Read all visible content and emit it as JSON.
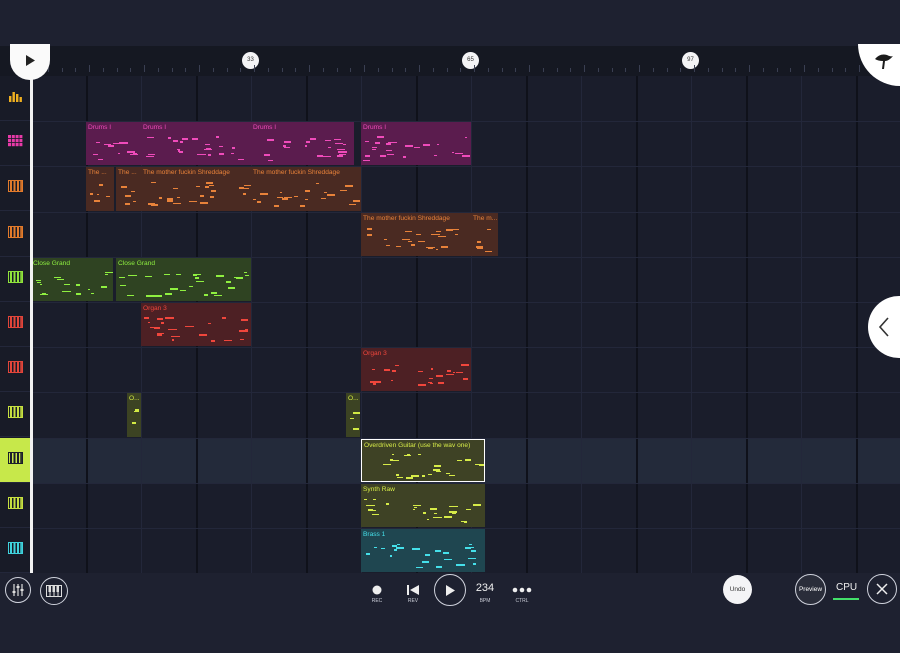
{
  "timeline": {
    "bar_markers": [
      "33",
      "65",
      "97"
    ]
  },
  "tracks": [
    {
      "icon": "equalizer-icon",
      "color": "#f0b020"
    },
    {
      "icon": "drum-pads-icon",
      "color": "#e83aa8"
    },
    {
      "icon": "piano-keys-icon",
      "color": "#e37b2b"
    },
    {
      "icon": "piano-keys-icon",
      "color": "#e37b2b"
    },
    {
      "icon": "piano-keys-icon",
      "color": "#8fe33b"
    },
    {
      "icon": "piano-keys-icon",
      "color": "#e2453a"
    },
    {
      "icon": "piano-keys-icon",
      "color": "#e2453a"
    },
    {
      "icon": "piano-keys-icon",
      "color": "#c6e040"
    },
    {
      "icon": "piano-keys-icon",
      "color": "#c6e040"
    },
    {
      "icon": "piano-keys-icon",
      "color": "#c6e040"
    },
    {
      "icon": "piano-keys-icon",
      "color": "#3fd3dd"
    }
  ],
  "clips": [
    {
      "label": "Drums I",
      "track": 1,
      "bg": "#5b1c4e",
      "fg": "#f04bbb"
    },
    {
      "label": "Drums I",
      "track": 1,
      "bg": "#5b1c4e",
      "fg": "#f04bbb"
    },
    {
      "label": "Drums I",
      "track": 1,
      "bg": "#5b1c4e",
      "fg": "#f04bbb"
    },
    {
      "label": "Drums I",
      "track": 1,
      "bg": "#5b1c4e",
      "fg": "#f04bbb"
    },
    {
      "label": "The ...",
      "track": 2,
      "bg": "#4a2a22",
      "fg": "#e8823a"
    },
    {
      "label": "The ...",
      "track": 2,
      "bg": "#4a2a22",
      "fg": "#e8823a"
    },
    {
      "label": "The mother fuckin Shreddage",
      "track": 2,
      "bg": "#4a2a22",
      "fg": "#e8823a"
    },
    {
      "label": "The mother fuckin Shreddage",
      "track": 2,
      "bg": "#4a2a22",
      "fg": "#e8823a"
    },
    {
      "label": "The mother fuckin Shreddage",
      "track": 3,
      "bg": "#4a2a22",
      "fg": "#e8823a"
    },
    {
      "label": "The m...",
      "track": 3,
      "bg": "#4a2a22",
      "fg": "#e8823a"
    },
    {
      "label": "Close Grand",
      "track": 4,
      "bg": "#2f4322",
      "fg": "#8ff040"
    },
    {
      "label": "Close Grand",
      "track": 4,
      "bg": "#2f4322",
      "fg": "#8ff040"
    },
    {
      "label": "Organ 3",
      "track": 5,
      "bg": "#4d2024",
      "fg": "#f0463c"
    },
    {
      "label": "Organ 3",
      "track": 6,
      "bg": "#4d2024",
      "fg": "#f0463c"
    },
    {
      "label": "O...",
      "track": 7,
      "bg": "#3c4323",
      "fg": "#d2ea44"
    },
    {
      "label": "O...",
      "track": 7,
      "bg": "#3c4323",
      "fg": "#d2ea44"
    },
    {
      "label": "Overdriven Guitar (use the wav one)",
      "track": 8,
      "bg": "#3e4225",
      "fg": "#d7ec48",
      "selected": true
    },
    {
      "label": "Synth Raw",
      "track": 9,
      "bg": "#3e4225",
      "fg": "#d7ec48"
    },
    {
      "label": "Brass 1",
      "track": 10,
      "bg": "#1f4650",
      "fg": "#45e0ea"
    }
  ],
  "transport": {
    "rec_label": "REC",
    "rev_label": "REV",
    "bpm_value": "234",
    "bpm_label": "BPM",
    "ctrl_label": "CTRL"
  },
  "buttons": {
    "undo_label": "Undo",
    "preview_label": "Preview",
    "cpu_label": "CPU"
  }
}
